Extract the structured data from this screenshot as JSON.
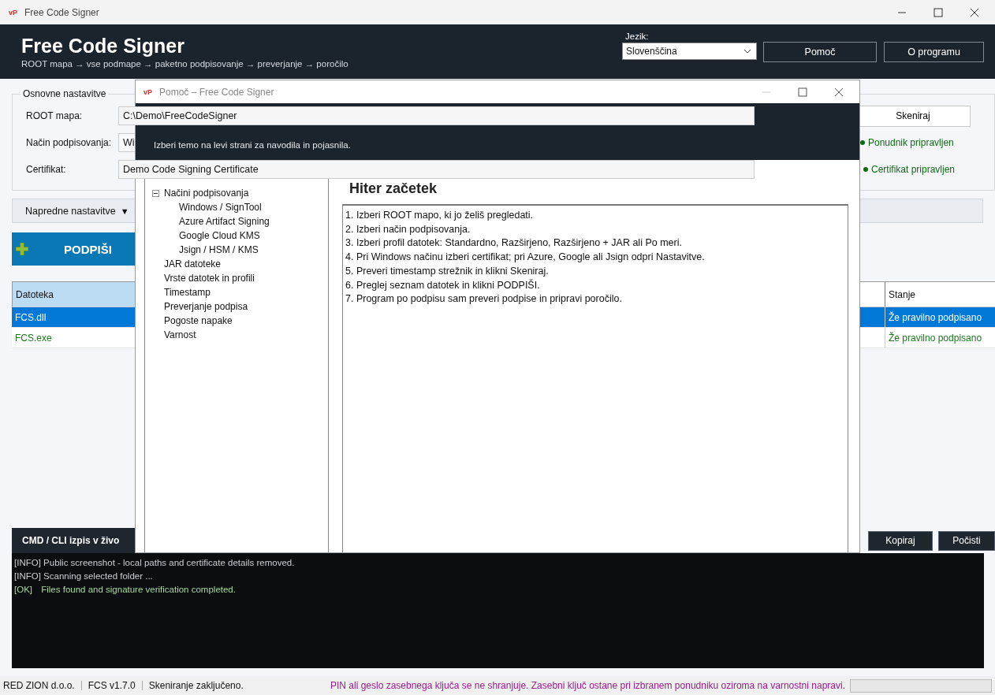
{
  "window": {
    "title": "Free Code Signer",
    "logo": "vP"
  },
  "header": {
    "title": "Free Code Signer",
    "subtitle": "ROOT mapa → vse podmape → paketno podpisovanje → preverjanje → poročilo",
    "language_label": "Jezik:",
    "language": "Slovenščina",
    "buttons": [
      "Pomoč",
      "O programu"
    ]
  },
  "basic_settings": {
    "title": "Osnovne nastavitve",
    "root_label": "ROOT mapa:",
    "root_value": "C:\\Demo\\FreeCodeSigner",
    "method_label": "Način podpisovanja:",
    "method_value": "Wi",
    "certificate_label": "Certifikat:",
    "certificate_value": "Demo Code Signing Certificate",
    "scan_button": "Skeniraj",
    "statuses": [
      {
        "text": "Ponudnik pripravljen",
        "color": "#0f6b12"
      },
      {
        "text": "Certifikat pripravljen",
        "color": "#0f6b12"
      }
    ]
  },
  "advanced": {
    "label": "Napredne nastavitve",
    "toggle": "▼"
  },
  "sign_button": "PODPIŠI",
  "files": {
    "columns": [
      "Datoteka",
      "Stanje"
    ],
    "rows": [
      {
        "name": "FCS.dll",
        "status": "Že pravilno podpisano",
        "selected": true
      },
      {
        "name": "FCS.exe",
        "status": "Že pravilno podpisano",
        "selected": false
      }
    ]
  },
  "log": {
    "title": "CMD / CLI izpis v živo",
    "buttons": [
      "Kopiraj",
      "Počisti"
    ],
    "lines": [
      {
        "kind": "info",
        "tag": "[INFO]",
        "text": "Public screenshot - local paths and certificate details removed."
      },
      {
        "kind": "info",
        "tag": "[INFO]",
        "text": "Scanning selected folder ..."
      },
      {
        "kind": "ok",
        "tag": "[OK]",
        "text": "Files found and signature verification completed."
      }
    ]
  },
  "status_bar": {
    "items": [
      "RED ZION d.o.o.",
      "FCS v1.7.0",
      "Skeniranje zaključeno."
    ],
    "notice": "PIN ali geslo zasebnega ključa se ne shranjuje. Zasebni ključ ostane pri izbranem ponudniku oziroma na varnostni napravi.",
    "level": 0
  },
  "help_window": {
    "logo": "vP",
    "title": "Pomoč – Free Code Signer",
    "subtitle": "Izberi temo na levi strani za navodila in pojasnila.",
    "heading": "Hiter začetek",
    "tree": [
      {
        "label": "Načini podpisovanja",
        "expanded": true,
        "children": [
          {
            "label": "Windows / SignTool"
          },
          {
            "label": "Azure Artifact Signing"
          },
          {
            "label": "Google Cloud KMS"
          },
          {
            "label": "Jsign / HSM / KMS"
          }
        ]
      },
      {
        "label": "JAR datoteke"
      },
      {
        "label": "Vrste datotek in profili"
      },
      {
        "label": "Timestamp"
      },
      {
        "label": "Preverjanje podpisa"
      },
      {
        "label": "Pogoste napake"
      },
      {
        "label": "Varnost"
      }
    ],
    "steps": [
      "1. Izberi ROOT mapo, ki jo želiš pregledati.",
      "2. Izberi način podpisovanja.",
      "3. Izberi profil datotek: Standardno, Razširjeno, Razširjeno + JAR ali Po meri.",
      "4. Pri Windows načinu izberi certifikat; pri Azure, Google ali Jsign odpri Nastavitve.",
      "5. Preveri timestamp strežnik in klikni Skeniraj.",
      "6. Preglej seznam datotek in klikni PODPIŠI.",
      "7. Program po podpisu sam preveri podpise in pripravi poročilo."
    ]
  }
}
